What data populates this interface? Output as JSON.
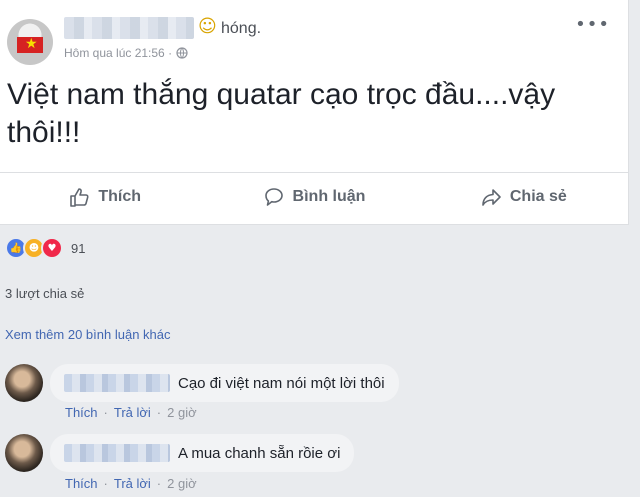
{
  "post": {
    "header_suffix": "hóng.",
    "timestamp": "Hôm qua lúc 21:56 ·",
    "text_line1": "Việt nam thắng quatar cạo trọc đầu....vậy",
    "text_line2": "thôi!!!"
  },
  "actions": {
    "like": "Thích",
    "comment": "Bình luận",
    "share": "Chia sẻ"
  },
  "reactions": {
    "count": "91",
    "types": [
      "like-icon",
      "haha-icon",
      "love-icon"
    ]
  },
  "shares": "3 lượt chia sẻ",
  "more_comments": "Xem thêm 20 bình luận khác",
  "comments": [
    {
      "text": "Cạo đi việt nam nói một lời thôi",
      "like": "Thích",
      "reply": "Trả lời",
      "time": "2 giờ"
    },
    {
      "text": "A mua chanh sẵn rồie ơi",
      "like": "Thích",
      "reply": "Trả lời",
      "time": "2 giờ"
    }
  ],
  "colors": {
    "link": "#4267b2",
    "muted": "#90949c",
    "background": "#e9ebee"
  }
}
